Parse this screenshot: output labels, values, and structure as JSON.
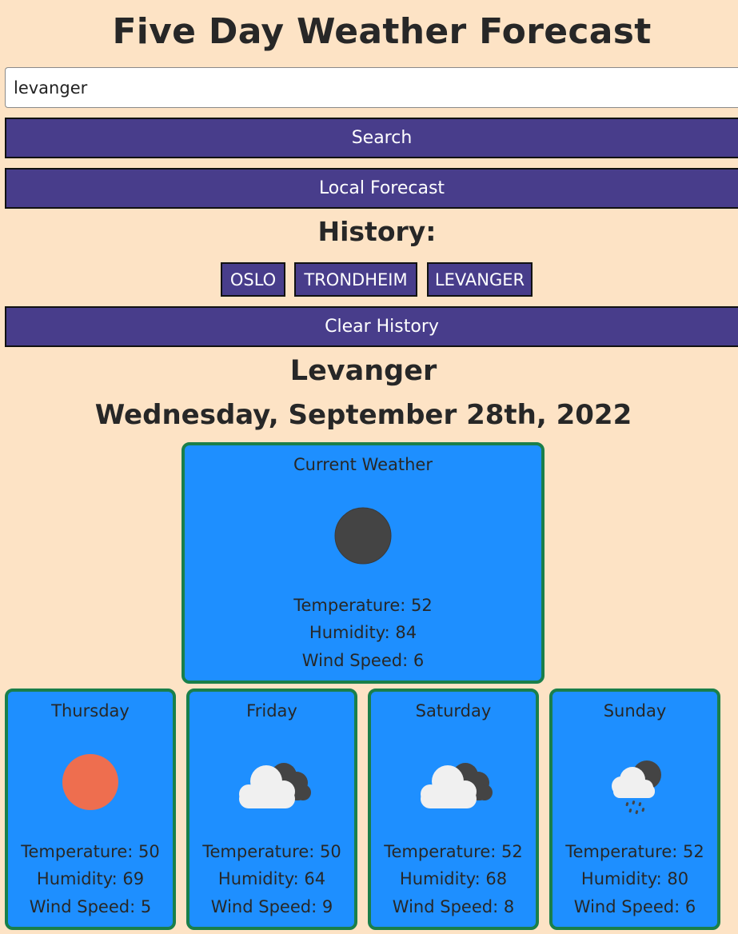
{
  "header": {
    "title": "Five Day Weather Forecast"
  },
  "search": {
    "value": "levanger",
    "button_label": "Search"
  },
  "local_forecast_label": "Local Forecast",
  "history": {
    "heading": "History:",
    "items": [
      "OSLO",
      "TRONDHEIM",
      "LEVANGER"
    ],
    "clear_label": "Clear History"
  },
  "location": {
    "city": "Levanger",
    "date": "Wednesday, September 28th, 2022"
  },
  "current": {
    "title": "Current Weather",
    "icon": "dark-circle-icon",
    "temperature": "Temperature: 52",
    "humidity": "Humidity: 84",
    "wind": "Wind Speed: 6"
  },
  "forecast": [
    {
      "day": "Thursday",
      "icon": "sun-icon",
      "temperature": "Temperature: 50",
      "humidity": "Humidity: 69",
      "wind": "Wind Speed: 5"
    },
    {
      "day": "Friday",
      "icon": "broken-clouds-icon",
      "temperature": "Temperature: 50",
      "humidity": "Humidity: 64",
      "wind": "Wind Speed: 9"
    },
    {
      "day": "Saturday",
      "icon": "broken-clouds-icon",
      "temperature": "Temperature: 52",
      "humidity": "Humidity: 68",
      "wind": "Wind Speed: 8"
    },
    {
      "day": "Sunday",
      "icon": "rain-cloud-icon",
      "temperature": "Temperature: 52",
      "humidity": "Humidity: 80",
      "wind": "Wind Speed: 6"
    }
  ],
  "colors": {
    "background": "#fde3c5",
    "button": "#483d8b",
    "card": "#1e8fff",
    "card_border": "#1a7f4a",
    "sun": "#ee6e4f",
    "dark_circle": "#444444"
  }
}
